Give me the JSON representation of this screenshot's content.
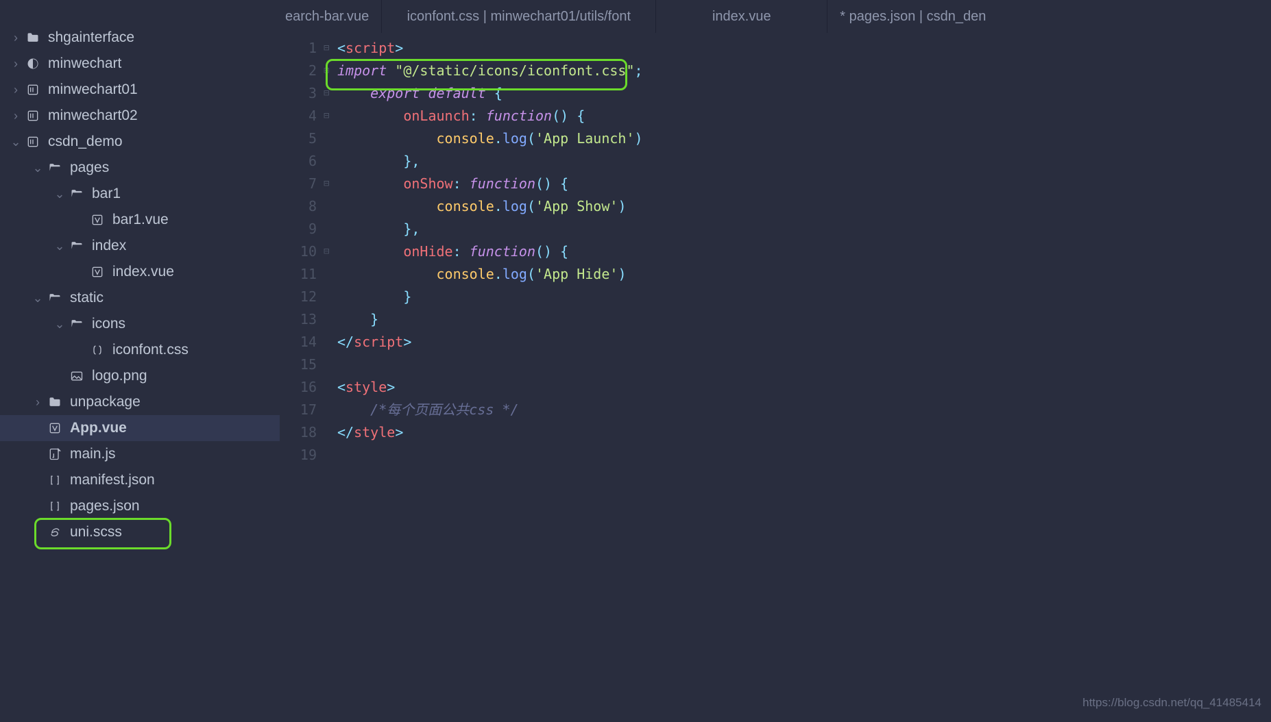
{
  "tabs": [
    {
      "label": "earch-bar.vue",
      "active": false
    },
    {
      "label": "iconfont.css | minwechart01/utils/font",
      "active": false
    },
    {
      "label": "index.vue",
      "active": false
    },
    {
      "label": "* pages.json | csdn_den",
      "active": false
    }
  ],
  "sidebar": [
    {
      "indent": 0,
      "chev": "›",
      "icon": "folder",
      "label": "shgainterface"
    },
    {
      "indent": 0,
      "chev": "›",
      "icon": "circle",
      "label": "minwechart"
    },
    {
      "indent": 0,
      "chev": "›",
      "icon": "box",
      "label": "minwechart01"
    },
    {
      "indent": 0,
      "chev": "›",
      "icon": "box",
      "label": "minwechart02"
    },
    {
      "indent": 0,
      "chev": "⌄",
      "icon": "box",
      "label": "csdn_demo"
    },
    {
      "indent": 1,
      "chev": "⌄",
      "icon": "folder-open",
      "label": "pages"
    },
    {
      "indent": 2,
      "chev": "⌄",
      "icon": "folder-open",
      "label": "bar1"
    },
    {
      "indent": 3,
      "chev": "",
      "icon": "vue",
      "label": "bar1.vue"
    },
    {
      "indent": 2,
      "chev": "⌄",
      "icon": "folder-open",
      "label": "index"
    },
    {
      "indent": 3,
      "chev": "",
      "icon": "vue",
      "label": "index.vue"
    },
    {
      "indent": 1,
      "chev": "⌄",
      "icon": "folder-open",
      "label": "static"
    },
    {
      "indent": 2,
      "chev": "⌄",
      "icon": "folder-open",
      "label": "icons"
    },
    {
      "indent": 3,
      "chev": "",
      "icon": "css",
      "label": "iconfont.css"
    },
    {
      "indent": 2,
      "chev": "",
      "icon": "img",
      "label": "logo.png"
    },
    {
      "indent": 1,
      "chev": "›",
      "icon": "folder",
      "label": "unpackage"
    },
    {
      "indent": 1,
      "chev": "",
      "icon": "vue",
      "label": "App.vue",
      "selected": true,
      "bold": true
    },
    {
      "indent": 1,
      "chev": "",
      "icon": "js",
      "label": "main.js"
    },
    {
      "indent": 1,
      "chev": "",
      "icon": "json",
      "label": "manifest.json"
    },
    {
      "indent": 1,
      "chev": "",
      "icon": "json",
      "label": "pages.json"
    },
    {
      "indent": 1,
      "chev": "",
      "icon": "scss",
      "label": "uni.scss"
    }
  ],
  "gutter": [
    "1",
    "2",
    "3",
    "4",
    "5",
    "6",
    "7",
    "8",
    "9",
    "10",
    "11",
    "12",
    "13",
    "14",
    "15",
    "16",
    "17",
    "18",
    "19"
  ],
  "fold": [
    "⊟",
    "⊟",
    "⊟",
    "⊟",
    "",
    "",
    "⊟",
    "",
    "",
    "⊟",
    "",
    "",
    "",
    "",
    "",
    "",
    "",
    "",
    ""
  ],
  "code": {
    "l1": {
      "a": "<",
      "b": "script",
      "c": ">"
    },
    "l2": {
      "a": "import",
      "b": "\"@/static/icons/iconfont.css\"",
      "c": ";"
    },
    "l3": {
      "a": "export default",
      "b": "{"
    },
    "l4": {
      "a": "onLaunch",
      "b": ":",
      "c": "function",
      "d": "()",
      "e": "{"
    },
    "l5": {
      "a": "console",
      "b": ".",
      "c": "log",
      "d": "(",
      "e": "'App Launch'",
      "f": ")"
    },
    "l6": {
      "a": "},"
    },
    "l7": {
      "a": "onShow",
      "b": ":",
      "c": "function",
      "d": "()",
      "e": "{"
    },
    "l8": {
      "a": "console",
      "b": ".",
      "c": "log",
      "d": "(",
      "e": "'App Show'",
      "f": ")"
    },
    "l9": {
      "a": "},"
    },
    "l10": {
      "a": "onHide",
      "b": ":",
      "c": "function",
      "d": "()",
      "e": "{"
    },
    "l11": {
      "a": "console",
      "b": ".",
      "c": "log",
      "d": "(",
      "e": "'App Hide'",
      "f": ")"
    },
    "l12": {
      "a": "}"
    },
    "l13": {
      "a": "}"
    },
    "l14": {
      "a": "</",
      "b": "script",
      "c": ">"
    },
    "l16": {
      "a": "<",
      "b": "style",
      "c": ">"
    },
    "l17": {
      "a": "/*每个页面公共css */"
    },
    "l18": {
      "a": "</",
      "b": "style",
      "c": ">"
    }
  },
  "watermark": "https://blog.csdn.net/qq_41485414"
}
